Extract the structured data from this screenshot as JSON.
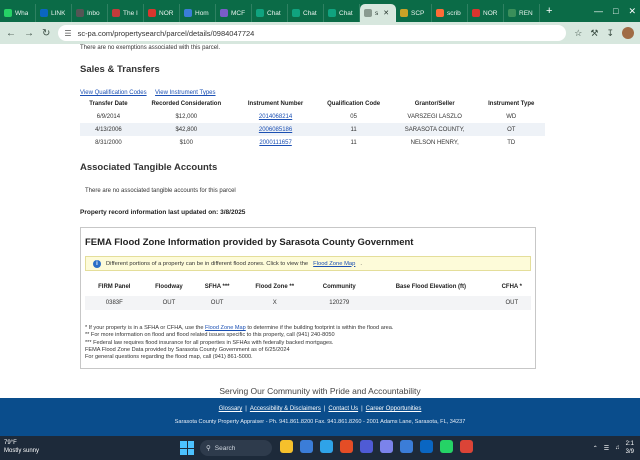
{
  "browser": {
    "tabs": [
      {
        "label": "Wha",
        "color": "#25d366"
      },
      {
        "label": "LINK",
        "color": "#0a66c2"
      },
      {
        "label": "Inbo",
        "color": "#555555"
      },
      {
        "label": "The I",
        "color": "#c33b3b"
      },
      {
        "label": "NOR",
        "color": "#d9352e"
      },
      {
        "label": "Hom",
        "color": "#3b7dd8"
      },
      {
        "label": "MCF",
        "color": "#7a5cc9"
      },
      {
        "label": "Chat",
        "color": "#10a37f"
      },
      {
        "label": "Chat",
        "color": "#10a37f"
      },
      {
        "label": "Chat",
        "color": "#10a37f"
      },
      {
        "label": "s",
        "color": "#8a9a90",
        "active": true
      },
      {
        "label": "SCP",
        "color": "#c9a227"
      },
      {
        "label": "scrib",
        "color": "#ff6c37"
      },
      {
        "label": "NOR",
        "color": "#d9352e"
      },
      {
        "label": "REN",
        "color": "#3a8f5a"
      }
    ],
    "new_tab": "+",
    "url": "sc-pa.com/propertysearch/parcel/details/0984047724"
  },
  "page": {
    "exemptions_note": "There are no exemptions associated with this parcel.",
    "sales": {
      "heading": "Sales & Transfers",
      "link_qualification": "View Qualification Codes",
      "link_instrument": "View Instrument Types",
      "columns": [
        "Transfer Date",
        "Recorded Consideration",
        "Instrument Number",
        "Qualification Code",
        "Grantor/Seller",
        "Instrument Type"
      ],
      "rows": [
        {
          "date": "6/9/2014",
          "consideration": "$12,000",
          "instrument": "2014068214",
          "qual": "05",
          "grantor": "VARSZEGI LASZLO",
          "type": "WD"
        },
        {
          "date": "4/13/2006",
          "consideration": "$42,800",
          "instrument": "2006085186",
          "qual": "11",
          "grantor": "SARASOTA COUNTY,",
          "type": "OT"
        },
        {
          "date": "8/31/2000",
          "consideration": "$100",
          "instrument": "2000111657",
          "qual": "11",
          "grantor": "NELSON HENRY,",
          "type": "TD"
        }
      ]
    },
    "tangible": {
      "heading": "Associated Tangible Accounts",
      "note": "There are no associated tangible accounts for this parcel"
    },
    "last_updated": "Property record information last updated on: 3/8/2025",
    "fema": {
      "title": "FEMA Flood Zone Information provided by Sarasota County Government",
      "notice_text": "Different portions of a property can be in different flood zones. Click to view the",
      "notice_link": "Flood Zone Map",
      "columns": [
        "FIRM Panel",
        "Floodway",
        "SFHA ***",
        "Flood Zone **",
        "Community",
        "Base Flood Elevation (ft)",
        "CFHA *"
      ],
      "row": [
        "0383F",
        "OUT",
        "OUT",
        "X",
        "120279",
        "",
        "OUT"
      ],
      "note1_pre": "* If your property is in a SFHA or CFHA, use the",
      "note1_link": "Flood Zone Map",
      "note1_post": "to determine if the building footprint is within the flood area.",
      "note2": "** For more information on flood and flood related issues specific to this property, call (941) 240-8050",
      "note3": "*** Federal law requires flood insurance for all properties in SFHAs with federally backed mortgages.",
      "note4": "FEMA Flood Zone Data provided by Sarasota County Government as of 6/25/2024",
      "note5": "For general questions regarding the flood map, call (941) 861-5000."
    },
    "slogan": "Serving Our Community with Pride and Accountability"
  },
  "footer": {
    "links": [
      "Glossary",
      "Accessibility & Disclaimers",
      "Contact Us",
      "Career Opportunities"
    ],
    "separator": "|",
    "address": "Sarasota County Property Appraiser - Ph. 941.861.8200 Fax. 941.861.8260 - 2001 Adams Lane, Sarasota, FL, 34237"
  },
  "taskbar": {
    "temp": "79°F",
    "weather": "Mostly sunny",
    "search_placeholder": "Search",
    "clock_time": "2:1",
    "clock_date": "3/9",
    "apps": [
      "#f5c02c",
      "#3b7dd8",
      "#2fa3e8",
      "#e44d26",
      "#4f5bd5",
      "#7b83eb",
      "#3b7dd8",
      "#0a66c2",
      "#25d366",
      "#db4437"
    ]
  }
}
